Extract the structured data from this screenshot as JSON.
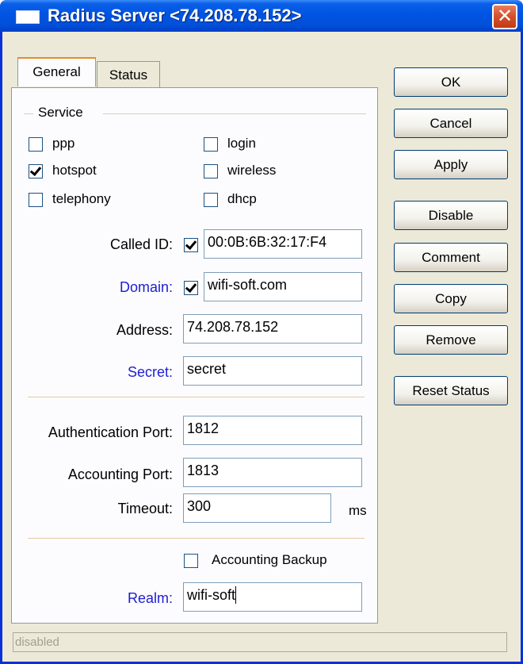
{
  "window": {
    "title": "Radius Server <74.208.78.152>"
  },
  "tabs": [
    {
      "label": "General",
      "active": true
    },
    {
      "label": "Status",
      "active": false
    }
  ],
  "service": {
    "group_label": "Service",
    "options": [
      {
        "label": "ppp",
        "checked": false
      },
      {
        "label": "login",
        "checked": false
      },
      {
        "label": "hotspot",
        "checked": true
      },
      {
        "label": "wireless",
        "checked": false
      },
      {
        "label": "telephony",
        "checked": false
      },
      {
        "label": "dhcp",
        "checked": false
      }
    ]
  },
  "fields": {
    "called_id": {
      "label": "Called ID:",
      "value": "00:0B:6B:32:17:F4",
      "enabled": true
    },
    "domain": {
      "label": "Domain:",
      "value": "wifi-soft.com",
      "enabled": true
    },
    "address": {
      "label": "Address:",
      "value": "74.208.78.152"
    },
    "secret": {
      "label": "Secret:",
      "value": "secret"
    },
    "auth_port": {
      "label": "Authentication Port:",
      "value": "1812"
    },
    "acct_port": {
      "label": "Accounting Port:",
      "value": "1813"
    },
    "timeout": {
      "label": "Timeout:",
      "value": "300",
      "unit": "ms"
    },
    "acct_backup": {
      "label": "Accounting Backup",
      "checked": false
    },
    "realm": {
      "label": "Realm:",
      "value": "wifi-soft"
    }
  },
  "buttons": {
    "ok": "OK",
    "cancel": "Cancel",
    "apply": "Apply",
    "disable": "Disable",
    "comment": "Comment",
    "copy": "Copy",
    "remove": "Remove",
    "reset_status": "Reset Status"
  },
  "status_bar": "disabled"
}
